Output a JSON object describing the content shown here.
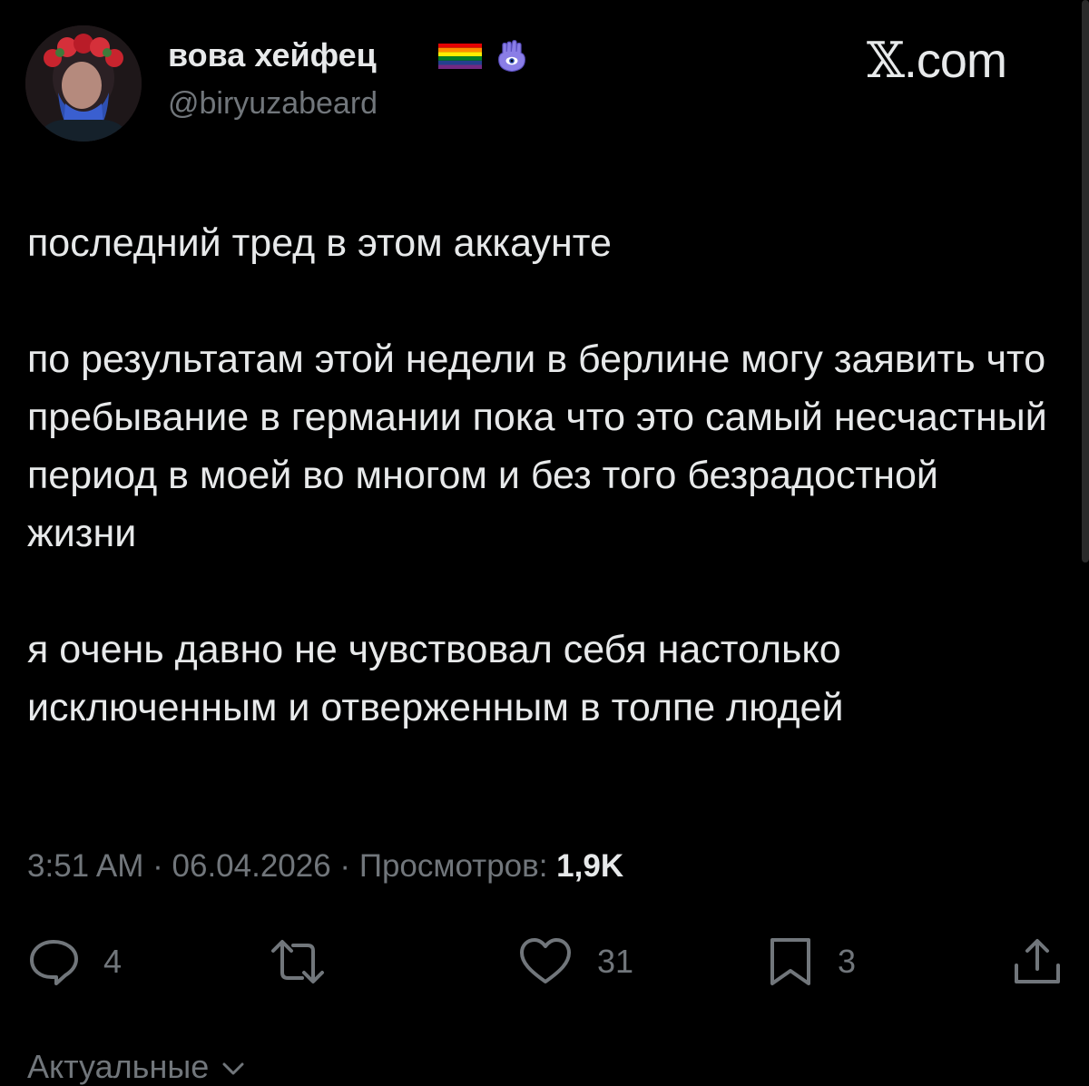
{
  "author": {
    "display_name": "вова хейфец",
    "handle": "@biryuzabeard",
    "avatar_icon": "avatar-photo",
    "name_emojis": [
      "rainbow-flag-icon",
      "hamsa-icon"
    ]
  },
  "brand": {
    "x_mark": "𝕏",
    "domain": ".com"
  },
  "tweet": {
    "paragraphs": [
      "последний тред в этом аккаунте",
      "по результатам этой недели в берлине могу заявить что пребывание в германии пока что это самый несчастный период в моей во многом и без того безрадостной жизни",
      "я очень давно не чувствовал себя настолько исключенным и отверженным в толпе людей"
    ],
    "time": "3:51 AM",
    "separator": " · ",
    "date": "06.04.2026",
    "views_label": "Просмотров: ",
    "views_count": "1,9K"
  },
  "actions": {
    "replies": "4",
    "retweets": "",
    "likes": "31",
    "bookmarks": "3"
  },
  "sort": {
    "label": "Актуальные"
  },
  "colors": {
    "background": "#000000",
    "text": "#e7e9ea",
    "muted": "#71767b"
  }
}
